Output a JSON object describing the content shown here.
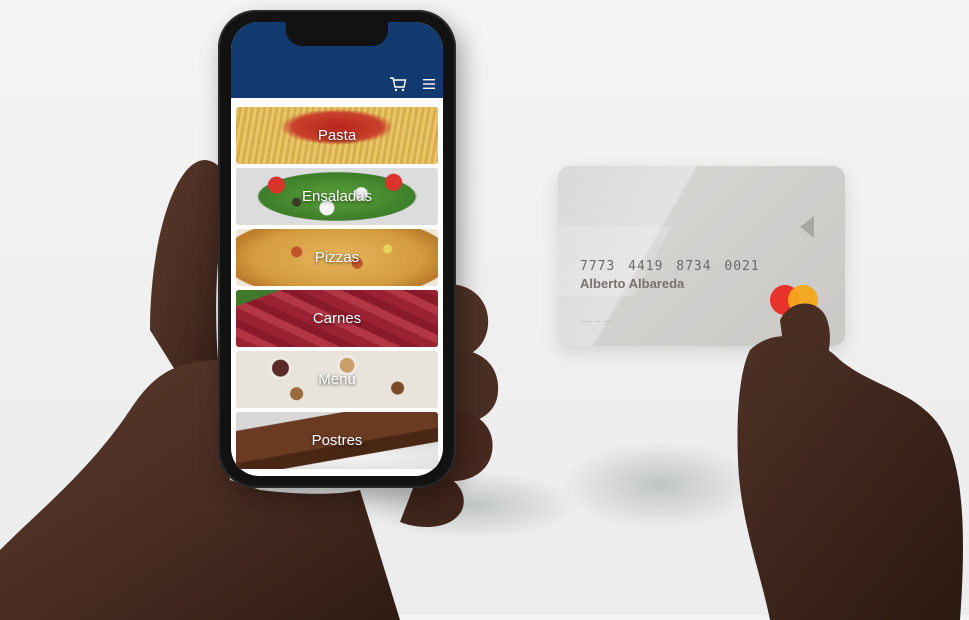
{
  "app": {
    "header": {
      "cart_icon": "cart-icon",
      "menu_icon": "hamburger-menu-icon"
    },
    "categories": [
      {
        "label": "Pasta"
      },
      {
        "label": "Ensaladas"
      },
      {
        "label": "Pizzas"
      },
      {
        "label": "Carnes"
      },
      {
        "label": "Menú"
      },
      {
        "label": "Postres"
      }
    ],
    "colors": {
      "header": "#123a6e",
      "screen_bg": "#ffffff"
    }
  },
  "card": {
    "number": "7773 4419 8734 0021",
    "holder": "Alberto Albareda",
    "small_text": "---- -- ---",
    "brand": "mastercard",
    "colors": {
      "body": "#d6d4d1",
      "mc_red": "#e8332d",
      "mc_yellow": "#f6a61b"
    }
  }
}
